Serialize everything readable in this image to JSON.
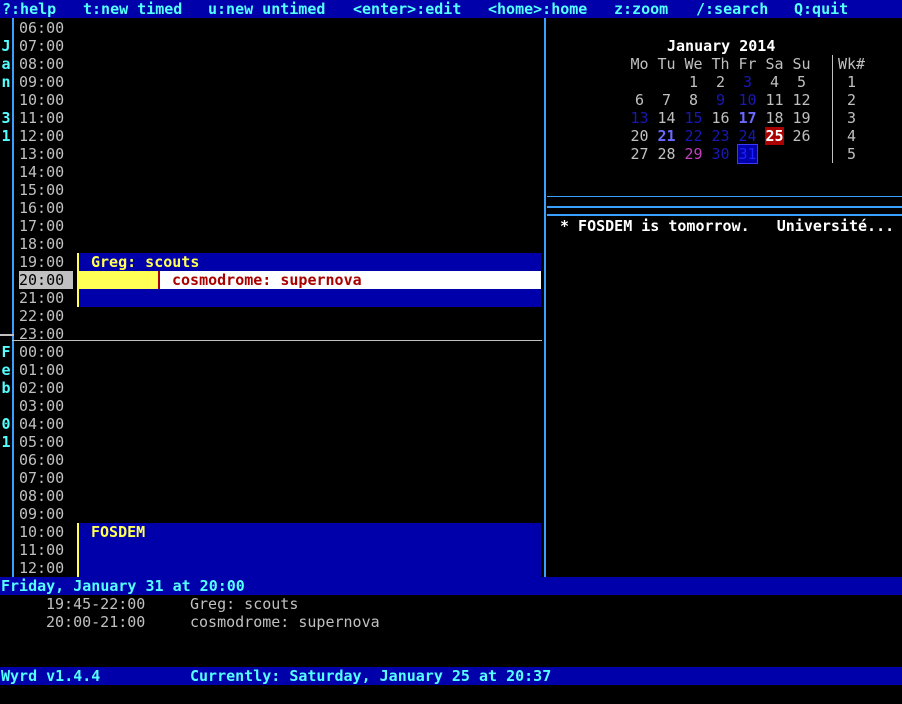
{
  "menu": [
    {
      "label": "?:help"
    },
    {
      "label": "t:new timed"
    },
    {
      "label": "u:new untimed"
    },
    {
      "label": "<enter>:edit"
    },
    {
      "label": "<home>:home"
    },
    {
      "label": "z:zoom"
    },
    {
      "label": "/:search"
    },
    {
      "label": "Q:quit"
    }
  ],
  "day1": {
    "letters": [
      "J",
      "a",
      "n",
      "",
      "3",
      "1"
    ],
    "hours": [
      "06:00",
      "07:00",
      "08:00",
      "09:00",
      "10:00",
      "11:00",
      "12:00",
      "13:00",
      "14:00",
      "15:00",
      "16:00",
      "17:00",
      "18:00",
      "19:00",
      "20:00",
      "21:00",
      "22:00",
      "23:00"
    ]
  },
  "day2": {
    "letters": [
      "F",
      "e",
      "b",
      "",
      "0",
      "1"
    ],
    "hours": [
      "00:00",
      "01:00",
      "02:00",
      "03:00",
      "04:00",
      "05:00",
      "06:00",
      "07:00",
      "08:00",
      "09:00",
      "10:00",
      "11:00",
      "12:00"
    ]
  },
  "events": {
    "greg": "Greg: scouts",
    "cosmo": "cosmodrome: supernova",
    "fosdem": "FOSDEM"
  },
  "calendar": {
    "title": "January 2014",
    "weekdays": [
      "Mo",
      "Tu",
      "We",
      "Th",
      "Fr",
      "Sa",
      "Su"
    ],
    "week_header": "Wk#",
    "weeks": [
      {
        "wk": "1",
        "days": [
          "",
          "",
          "1",
          "2",
          "3",
          "4",
          "5"
        ]
      },
      {
        "wk": "2",
        "days": [
          "6",
          "7",
          "8",
          "9",
          "10",
          "11",
          "12"
        ]
      },
      {
        "wk": "3",
        "days": [
          "13",
          "14",
          "15",
          "16",
          "17",
          "18",
          "19"
        ]
      },
      {
        "wk": "4",
        "days": [
          "20",
          "21",
          "22",
          "23",
          "24",
          "25",
          "26"
        ]
      },
      {
        "wk": "5",
        "days": [
          "27",
          "28",
          "29",
          "30",
          "31",
          "",
          ""
        ]
      }
    ]
  },
  "untimed_note": "* FOSDEM is tomorrow.   Université...",
  "status": {
    "selected_date": "Friday, January 31 at 20:00",
    "detail": [
      {
        "time": "19:45-22:00",
        "desc": "Greg: scouts"
      },
      {
        "time": "20:00-21:00",
        "desc": "cosmodrome: supernova"
      }
    ],
    "version": "Wyrd v1.4.4",
    "current": "Currently: Saturday, January 25 at 20:37"
  }
}
